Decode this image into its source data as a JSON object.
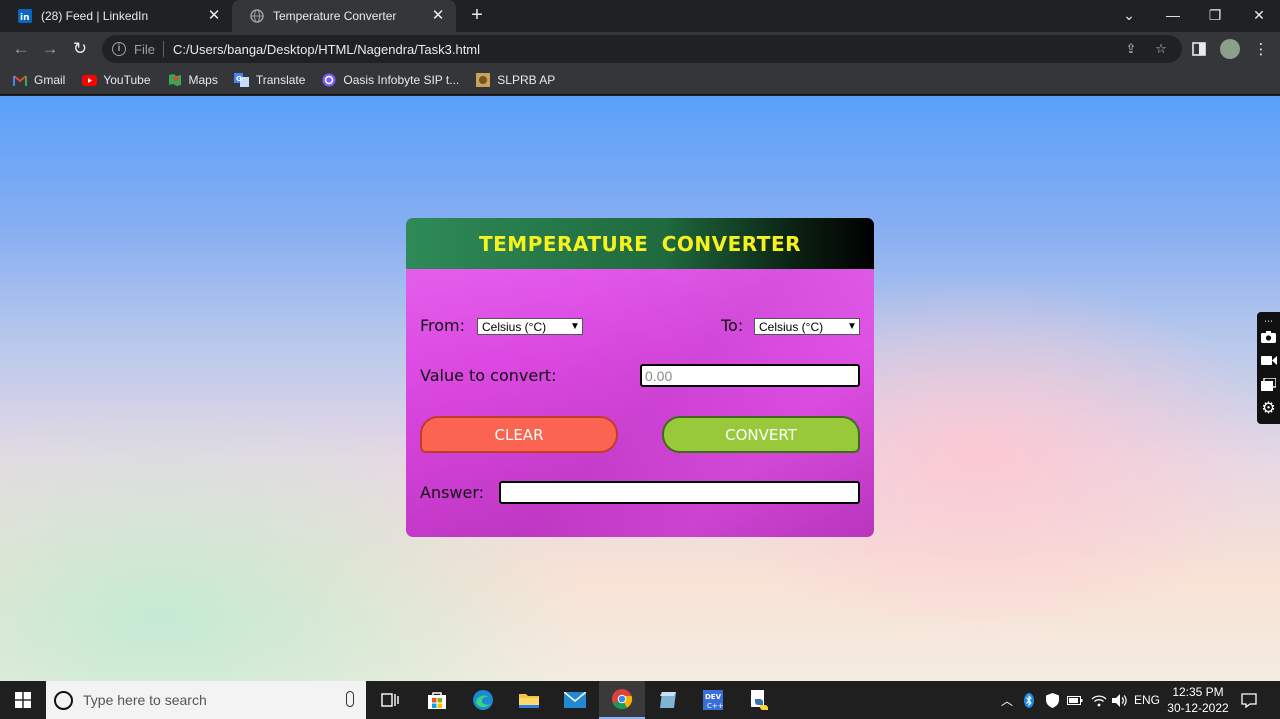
{
  "browser": {
    "tabs": [
      {
        "title": "(28) Feed | LinkedIn",
        "active": false
      },
      {
        "title": "Temperature Converter",
        "active": true
      }
    ],
    "address": {
      "scheme_label": "File",
      "url": "C:/Users/banga/Desktop/HTML/Nagendra/Task3.html"
    },
    "bookmarks": [
      {
        "label": "Gmail",
        "icon": "gmail-icon",
        "color": "#ea4335"
      },
      {
        "label": "YouTube",
        "icon": "youtube-icon",
        "color": "#ff0000"
      },
      {
        "label": "Maps",
        "icon": "maps-icon",
        "color": "#34a853"
      },
      {
        "label": "Translate",
        "icon": "translate-icon",
        "color": "#4285f4"
      },
      {
        "label": "Oasis Infobyte SIP t...",
        "icon": "oasis-icon",
        "color": "#7b5cff"
      },
      {
        "label": "SLPRB AP",
        "icon": "slprb-icon",
        "color": "#c9a15a"
      }
    ]
  },
  "converter": {
    "title": "TEMPERATURE CONVERTER",
    "from_label": "From:",
    "from_value": "Celsius (°C)",
    "to_label": "To:",
    "to_value": "Celsius (°C)",
    "value_label": "Value to convert:",
    "value_placeholder": "0.00",
    "clear_label": "CLEAR",
    "convert_label": "CONVERT",
    "answer_label": "Answer:",
    "answer_value": "",
    "header_color": "#2e8a58",
    "title_color": "#f6f21d",
    "card_color": "#dc48e2",
    "clear_color": "#fa6450",
    "convert_color": "#97c93a"
  },
  "taskbar": {
    "search_placeholder": "Type here to search",
    "language": "ENG",
    "time": "12:35 PM",
    "date": "30-12-2022"
  }
}
